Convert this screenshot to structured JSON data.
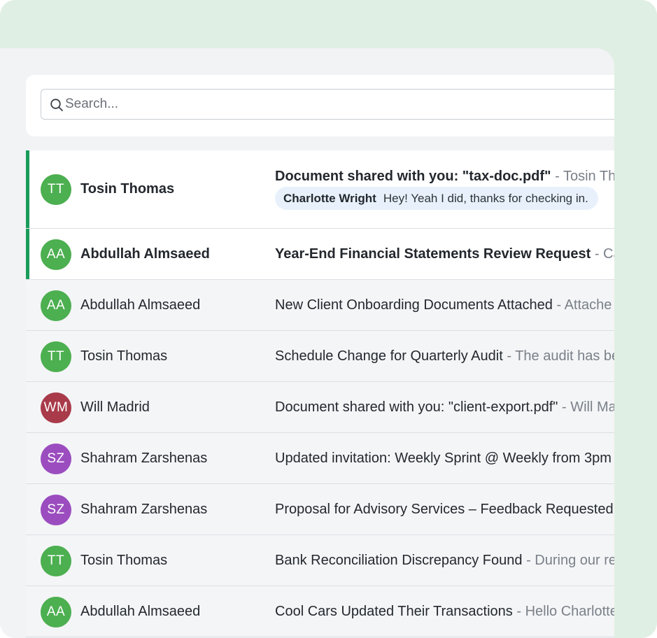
{
  "colors": {
    "outer_background": "#e0efe3",
    "panel_background": "#f1f3f5",
    "unread_accent": "#1a9c5a",
    "avatar_tt": "#4caf50",
    "avatar_aa": "#4caf50",
    "avatar_wm": "#a83a4a",
    "avatar_sz": "#9b4dbf",
    "reply_chip": "#e8f1fb"
  },
  "search": {
    "icon": "search-icon",
    "placeholder": "Search..."
  },
  "messages": [
    {
      "initials": "TT",
      "avatar_color": "#4caf50",
      "sender": "Tosin Thomas",
      "subject": "Document shared with you: \"tax-doc.pdf\"",
      "separator": " - ",
      "preview": "Tosin Thom",
      "unread": true,
      "reply": {
        "author": "Charlotte Wright",
        "text": "Hey! Yeah I did, thanks for checking in."
      }
    },
    {
      "initials": "AA",
      "avatar_color": "#4caf50",
      "sender": "Abdullah Almsaeed",
      "subject": "Year-End Financial Statements Review Request",
      "separator": " - ",
      "preview": "Can",
      "unread": true
    },
    {
      "initials": "AA",
      "avatar_color": "#4caf50",
      "sender": "Abdullah Almsaeed",
      "subject": "New Client Onboarding Documents Attached",
      "separator": " - ",
      "preview": "Attache",
      "unread": false
    },
    {
      "initials": "TT",
      "avatar_color": "#4caf50",
      "sender": "Tosin Thomas",
      "subject": "Schedule Change for Quarterly Audit",
      "separator": " - ",
      "preview": "The audit has be",
      "unread": false
    },
    {
      "initials": "WM",
      "avatar_color": "#a83a4a",
      "sender": "Will Madrid",
      "subject": "Document shared with you: \"client-export.pdf\"",
      "separator": " - ",
      "preview": "Will Ma",
      "unread": false
    },
    {
      "initials": "SZ",
      "avatar_color": "#9b4dbf",
      "sender": "Shahram Zarshenas",
      "subject": "Updated invitation: Weekly Sprint @ Weekly from 3pm",
      "separator": "",
      "preview": "",
      "unread": false
    },
    {
      "initials": "SZ",
      "avatar_color": "#9b4dbf",
      "sender": "Shahram Zarshenas",
      "subject": "Proposal for Advisory Services – Feedback Requested",
      "separator": "",
      "preview": "",
      "unread": false
    },
    {
      "initials": "TT",
      "avatar_color": "#4caf50",
      "sender": "Tosin Thomas",
      "subject": "Bank Reconciliation Discrepancy Found",
      "separator": " - ",
      "preview": "During our re",
      "unread": false
    },
    {
      "initials": "AA",
      "avatar_color": "#4caf50",
      "sender": "Abdullah Almsaeed",
      "subject": "Cool Cars Updated Their Transactions",
      "separator": " - ",
      "preview": "Hello Charlotte",
      "unread": false
    }
  ]
}
